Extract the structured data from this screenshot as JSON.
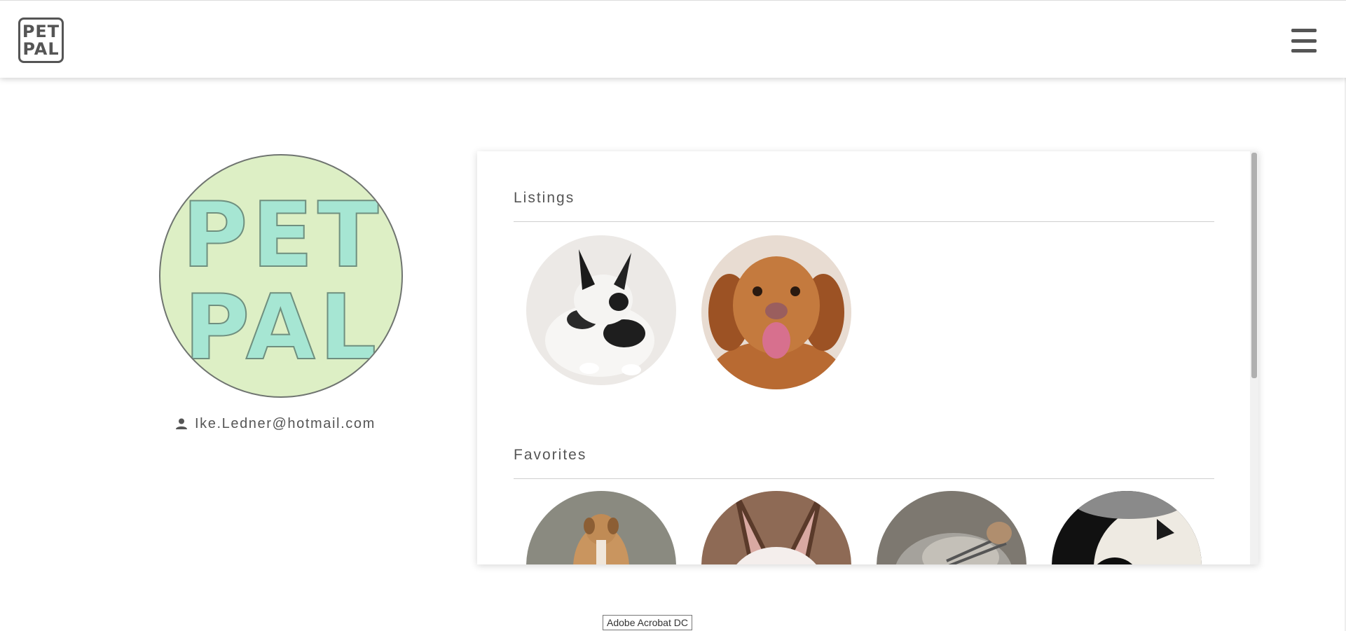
{
  "header": {
    "logo_line1": "PET",
    "logo_line2": "PAL",
    "menu_icon": "hamburger-menu-icon"
  },
  "profile": {
    "avatar_text_line1": "PET",
    "avatar_text_line2": "PAL",
    "user_icon": "person-icon",
    "email": "Ike.Ledner@hotmail.com"
  },
  "listings": {
    "title": "Listings",
    "items": [
      {
        "animal": "rabbit"
      },
      {
        "animal": "dog"
      }
    ]
  },
  "favorites": {
    "title": "Favorites",
    "items": [
      {
        "animal": "dog"
      },
      {
        "animal": "rabbit"
      },
      {
        "animal": "kitten"
      },
      {
        "animal": "puppy"
      }
    ]
  },
  "tooltip": {
    "text": "Adobe Acrobat DC"
  },
  "colors": {
    "avatar_bg": "#ddefc5",
    "avatar_letters": "#a6e6d3",
    "text": "#555555"
  }
}
